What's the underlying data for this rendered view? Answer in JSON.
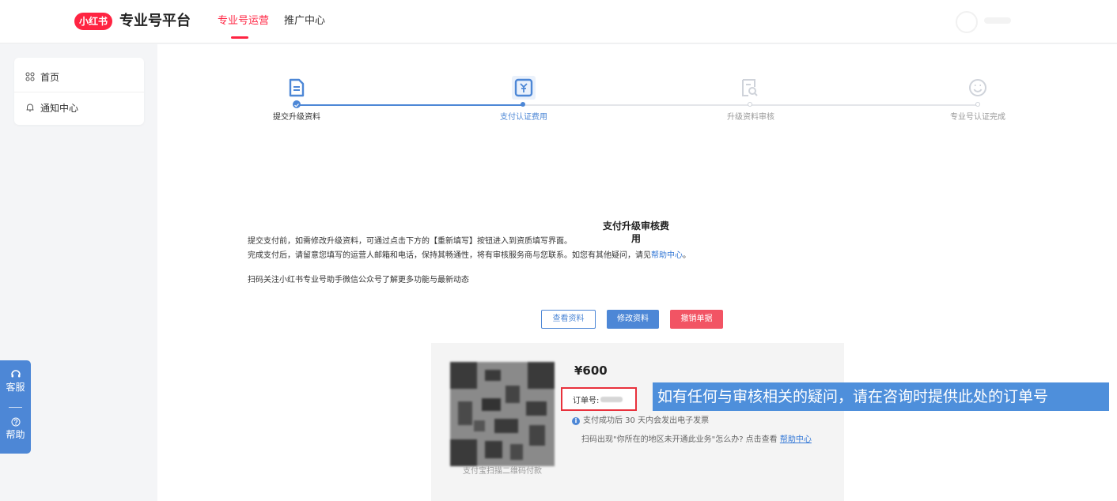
{
  "header": {
    "logo_text": "小红书",
    "platform_title": "专业号平台",
    "tabs": [
      {
        "label": "专业号运营",
        "active": true
      },
      {
        "label": "推广中心",
        "active": false
      }
    ]
  },
  "sidebar": {
    "items": [
      {
        "label": "首页",
        "icon": "grid-icon"
      },
      {
        "label": "通知中心",
        "icon": "bell-icon"
      }
    ]
  },
  "float_widget": {
    "service_label": "客服",
    "help_label": "帮助"
  },
  "steps": [
    {
      "label": "提交升级资料",
      "status": "done"
    },
    {
      "label": "支付认证费用",
      "status": "current"
    },
    {
      "label": "升级资料审核",
      "status": "pending"
    },
    {
      "label": "专业号认证完成",
      "status": "pending"
    }
  ],
  "payment": {
    "title": "支付升级审核费用",
    "desc_line1": "提交支付前，如需修改升级资料，可通过点击下方的【重新填写】按钮进入到资质填写界面。",
    "desc_line2_prefix": "完成支付后，请留意您填写的运营人邮箱和电话，保持其畅通性，将有审核服务商与您联系。如您有其他疑问，请见",
    "desc_line2_link": "帮助中心",
    "desc_line2_suffix": "。",
    "desc_line3": "扫码关注小红书专业号助手微信公众号了解更多功能与最新动态",
    "buttons": {
      "view": "查看资料",
      "edit": "修改资料",
      "cancel": "撤销单据"
    },
    "qr_caption": "支付宝扫描二维码付款",
    "price": "¥600",
    "order_label": "订单号:",
    "invoice_note": "支付成功后 30 天内会发出电子发票",
    "region_note_prefix": "扫码出现\"你所在的地区未开通此业务\"怎么办? 点击查看",
    "region_note_link": "帮助中心"
  },
  "callout": {
    "text": "如有任何与审核相关的疑问，请在咨询时提供此处的订单号"
  },
  "colors": {
    "brand_red": "#ff2442",
    "primary_blue": "#4d87d6",
    "danger_red": "#f25464",
    "callout_blue": "#4e8fdb"
  }
}
